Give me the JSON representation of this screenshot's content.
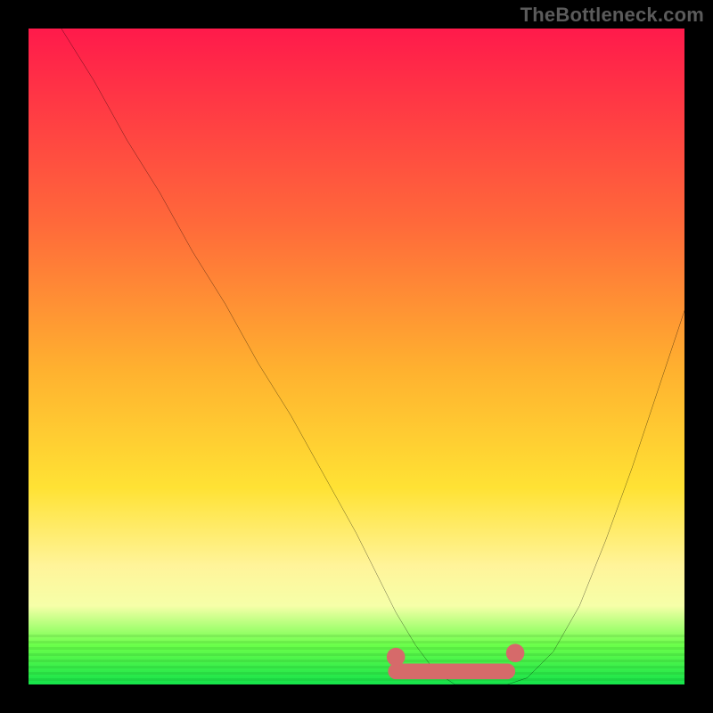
{
  "attribution": "TheBottleneck.com",
  "colors": {
    "frame": "#000000",
    "grad_top": "#ff1a4b",
    "grad_mid": "#ffe234",
    "grad_bottom": "#15e24a",
    "curve": "#000000",
    "marker": "#d66a6a"
  },
  "chart_data": {
    "type": "line",
    "title": "",
    "xlabel": "",
    "ylabel": "",
    "xlim": [
      0,
      100
    ],
    "ylim": [
      0,
      100
    ],
    "grid": false,
    "legend": "none",
    "series": [
      {
        "name": "curve",
        "x": [
          5,
          10,
          15,
          20,
          25,
          30,
          35,
          40,
          45,
          50,
          53,
          56,
          59,
          62,
          65,
          68,
          70,
          73,
          76,
          80,
          84,
          88,
          92,
          96,
          100
        ],
        "y": [
          100,
          92,
          83,
          75,
          66,
          58,
          49,
          41,
          32,
          23,
          17,
          11,
          6,
          2,
          0,
          0,
          0,
          0,
          1,
          5,
          12,
          22,
          33,
          45,
          57
        ]
      }
    ],
    "annotations": [
      {
        "name": "flat-minimum-marker",
        "x_range": [
          56,
          73
        ],
        "y": 2
      }
    ],
    "background_gradient": [
      "#ff1a4b",
      "#ff6a3a",
      "#ffe234",
      "#fff49a",
      "#15e24a"
    ]
  }
}
